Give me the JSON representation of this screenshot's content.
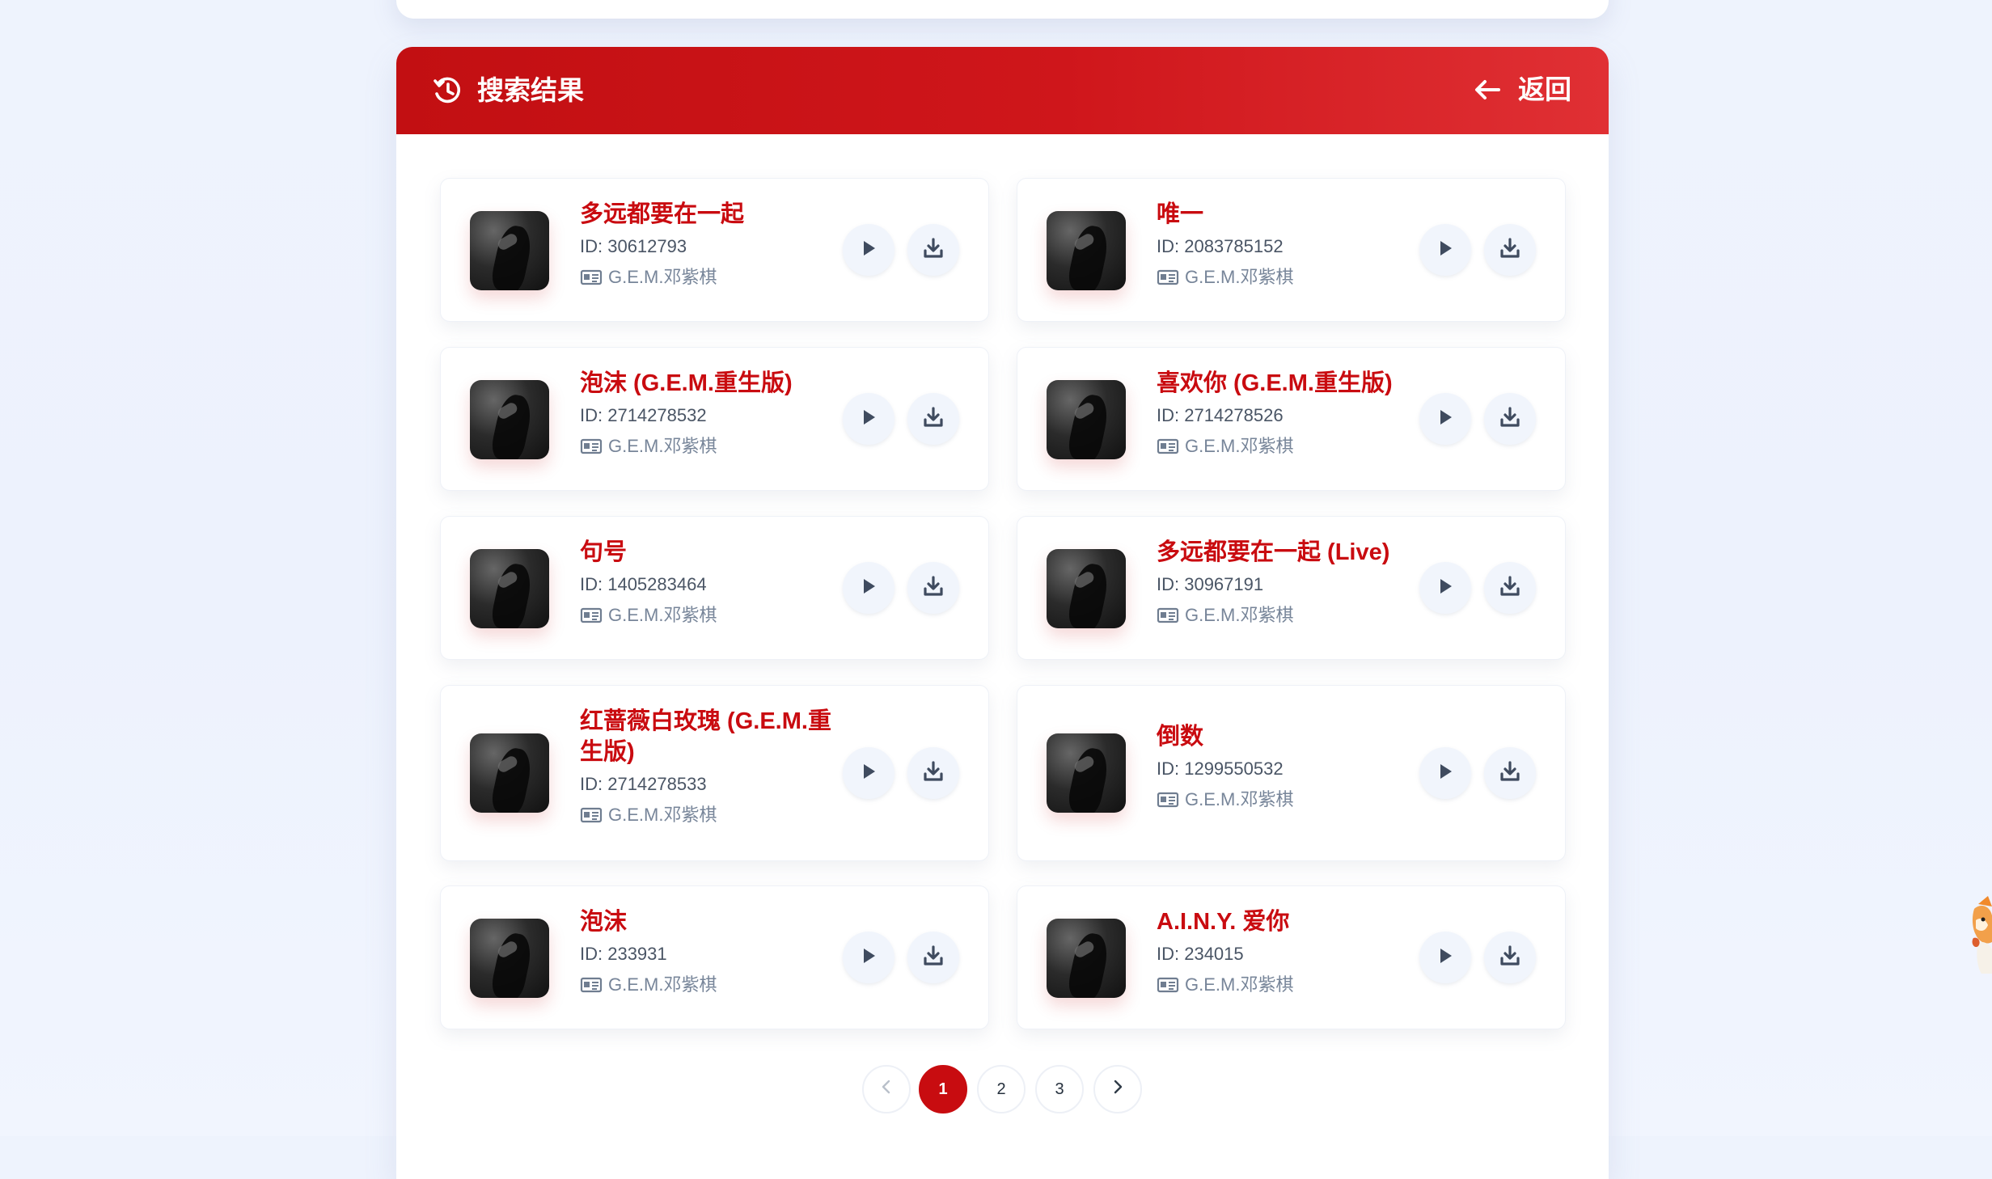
{
  "panel": {
    "title": "搜索结果",
    "back_label": "返回"
  },
  "songs": [
    {
      "title": "多远都要在一起",
      "id_text": "ID: 30612793",
      "artist": "G.E.M.邓紫棋"
    },
    {
      "title": "唯一",
      "id_text": "ID: 2083785152",
      "artist": "G.E.M.邓紫棋"
    },
    {
      "title": "泡沫 (G.E.M.重生版)",
      "id_text": "ID: 2714278532",
      "artist": "G.E.M.邓紫棋"
    },
    {
      "title": "喜欢你 (G.E.M.重生版)",
      "id_text": "ID: 2714278526",
      "artist": "G.E.M.邓紫棋"
    },
    {
      "title": "句号",
      "id_text": "ID: 1405283464",
      "artist": "G.E.M.邓紫棋"
    },
    {
      "title": "多远都要在一起 (Live)",
      "id_text": "ID: 30967191",
      "artist": "G.E.M.邓紫棋"
    },
    {
      "title": "红蔷薇白玫瑰 (G.E.M.重生版)",
      "id_text": "ID: 2714278533",
      "artist": "G.E.M.邓紫棋"
    },
    {
      "title": "倒数",
      "id_text": "ID: 1299550532",
      "artist": "G.E.M.邓紫棋"
    },
    {
      "title": "泡沫",
      "id_text": "ID: 233931",
      "artist": "G.E.M.邓紫棋"
    },
    {
      "title": "A.I.N.Y. 爱你",
      "id_text": "ID: 234015",
      "artist": "G.E.M.邓紫棋"
    }
  ],
  "pagination": {
    "pages": [
      "1",
      "2",
      "3"
    ],
    "active_page": "1"
  },
  "icons": {
    "header": "history-icon",
    "back": "arrow-left-icon",
    "artist": "id-card-icon",
    "play": "play-icon",
    "download": "download-icon",
    "previous": "chevron-left-icon",
    "next": "chevron-right-icon"
  },
  "colors": {
    "header_red": "#c90f12",
    "title_red": "#c90b10",
    "page_background": "#eef3fd",
    "button_background": "#f1f5fc",
    "icon_gray": "#3f4b5f"
  }
}
